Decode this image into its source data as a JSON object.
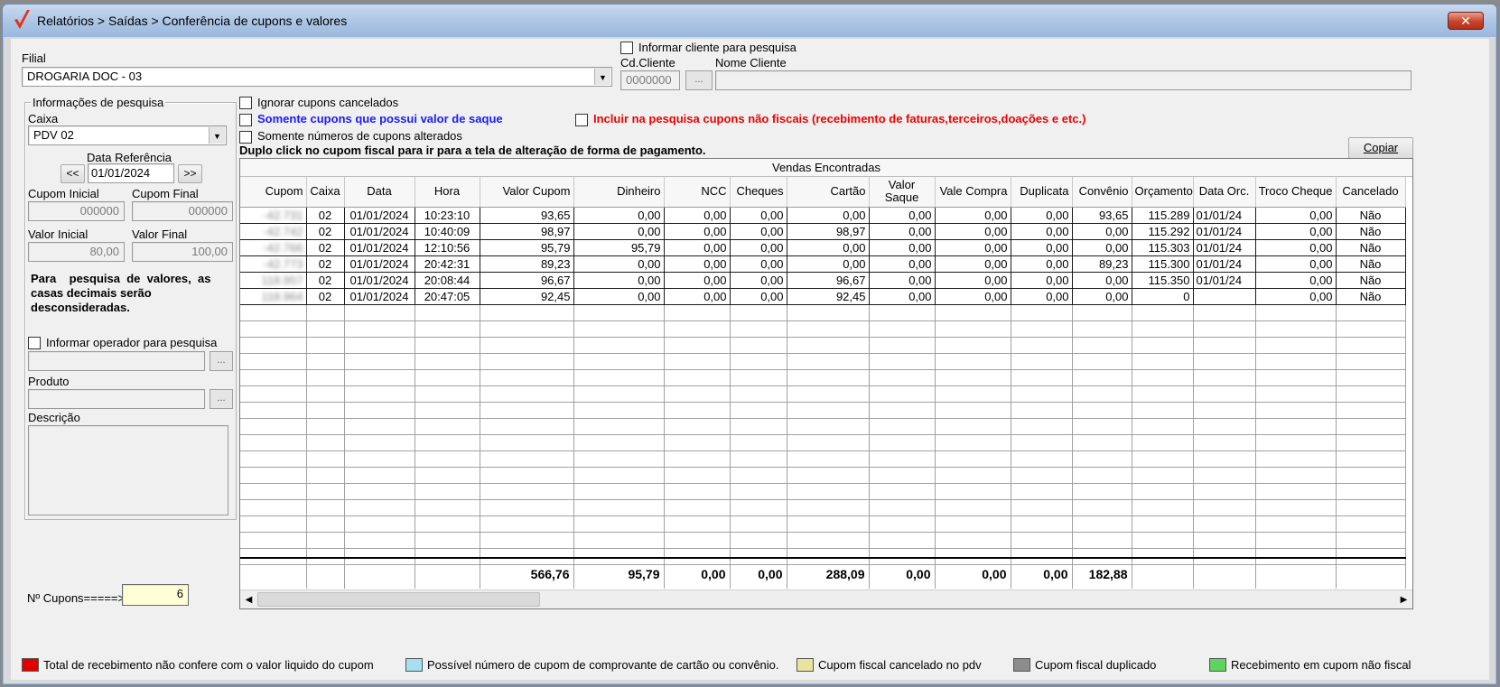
{
  "window": {
    "title": "Relatórios > Saídas > Conferência de cupons e valores",
    "close_glyph": "✕"
  },
  "filial": {
    "label": "Filial",
    "value": "DROGARIA DOC - 03"
  },
  "cliente": {
    "checkbox_label": "Informar cliente para pesquisa",
    "cd_label": "Cd.Cliente",
    "cd_value": "0000000",
    "nome_label": "Nome Cliente",
    "nome_value": "",
    "lookup_label": "..."
  },
  "pesquisa": {
    "group_title": "Informações de pesquisa",
    "caixa_label": "Caixa",
    "caixa_value": "PDV 02",
    "data_ref_label": "Data Referência",
    "data_ref_value": "01/01/2024",
    "prev_label": "<<",
    "next_label": ">>",
    "cupom_inicial_label": "Cupom Inicial",
    "cupom_inicial_value": "000000",
    "cupom_final_label": "Cupom Final",
    "cupom_final_value": "000000",
    "valor_inicial_label": "Valor Inicial",
    "valor_inicial_value": "80,00",
    "valor_final_label": "Valor Final",
    "valor_final_value": "100,00",
    "note": "Para    pesquisa  de  valores,  as    casas decimais serão desconsideradas.",
    "operador_label": "Informar operador para pesquisa",
    "operador_value": "",
    "produto_label": "Produto",
    "produto_value": "",
    "descricao_label": "Descrição",
    "lookup_label": "..."
  },
  "options": {
    "ignorar": "Ignorar cupons cancelados",
    "saque": "Somente cupons que possui valor de saque",
    "nao_fiscais": "Incluir na pesquisa cupons não fiscais (recebimento de faturas,terceiros,doações  e etc.)",
    "alterados": "Somente números de cupons alterados",
    "hint": "Duplo click no cupom fiscal para ir para a tela de alteração de forma de pagamento.",
    "copiar": "Copiar"
  },
  "grid": {
    "caption": "Vendas Encontradas",
    "columns": [
      "Cupom",
      "Caixa",
      "Data",
      "Hora",
      "Valor Cupom",
      "Dinheiro",
      "NCC",
      "Cheques",
      "Cartão",
      "Valor Saque",
      "Vale Compra",
      "Duplicata",
      "Convênio",
      "Orçamento",
      "Data Orc.",
      "Troco Cheque",
      "Cancelado"
    ],
    "rows": [
      [
        "-42.731",
        "02",
        "01/01/2024",
        "10:23:10",
        "93,65",
        "0,00",
        "0,00",
        "0,00",
        "0,00",
        "0,00",
        "0,00",
        "0,00",
        "93,65",
        "115.289",
        "01/01/24",
        "0,00",
        "Não"
      ],
      [
        "-42.742",
        "02",
        "01/01/2024",
        "10:40:09",
        "98,97",
        "0,00",
        "0,00",
        "0,00",
        "98,97",
        "0,00",
        "0,00",
        "0,00",
        "0,00",
        "115.292",
        "01/01/24",
        "0,00",
        "Não"
      ],
      [
        "-42.766",
        "02",
        "01/01/2024",
        "12:10:56",
        "95,79",
        "95,79",
        "0,00",
        "0,00",
        "0,00",
        "0,00",
        "0,00",
        "0,00",
        "0,00",
        "115.303",
        "01/01/24",
        "0,00",
        "Não"
      ],
      [
        "-42.773",
        "02",
        "01/01/2024",
        "20:42:31",
        "89,23",
        "0,00",
        "0,00",
        "0,00",
        "0,00",
        "0,00",
        "0,00",
        "0,00",
        "89,23",
        "115.300",
        "01/01/24",
        "0,00",
        "Não"
      ],
      [
        "118.957",
        "02",
        "01/01/2024",
        "20:08:44",
        "96,67",
        "0,00",
        "0,00",
        "0,00",
        "96,67",
        "0,00",
        "0,00",
        "0,00",
        "0,00",
        "115.350",
        "01/01/24",
        "0,00",
        "Não"
      ],
      [
        "118.964",
        "02",
        "01/01/2024",
        "20:47:05",
        "92,45",
        "0,00",
        "0,00",
        "0,00",
        "92,45",
        "0,00",
        "0,00",
        "0,00",
        "0,00",
        "0",
        "",
        "0,00",
        "Não"
      ]
    ],
    "totals": [
      "",
      "",
      "",
      "",
      "566,76",
      "95,79",
      "0,00",
      "0,00",
      "288,09",
      "0,00",
      "0,00",
      "0,00",
      "182,88",
      "",
      "",
      "",
      ""
    ]
  },
  "count": {
    "label": "Nº Cupons=====>",
    "value": "6"
  },
  "legend": [
    {
      "color": "#e00000",
      "label": "Total de recebimento não confere com o valor liquido do cupom"
    },
    {
      "color": "#a6dff0",
      "label": "Possível número de cupom de comprovante de cartão ou convênio."
    },
    {
      "color": "#e9e3a0",
      "label": "Cupom fiscal cancelado no pdv"
    },
    {
      "color": "#8c8c8c",
      "label": "Cupom fiscal duplicado"
    },
    {
      "color": "#5fd35f",
      "label": "Recebimento em cupom não fiscal"
    }
  ]
}
